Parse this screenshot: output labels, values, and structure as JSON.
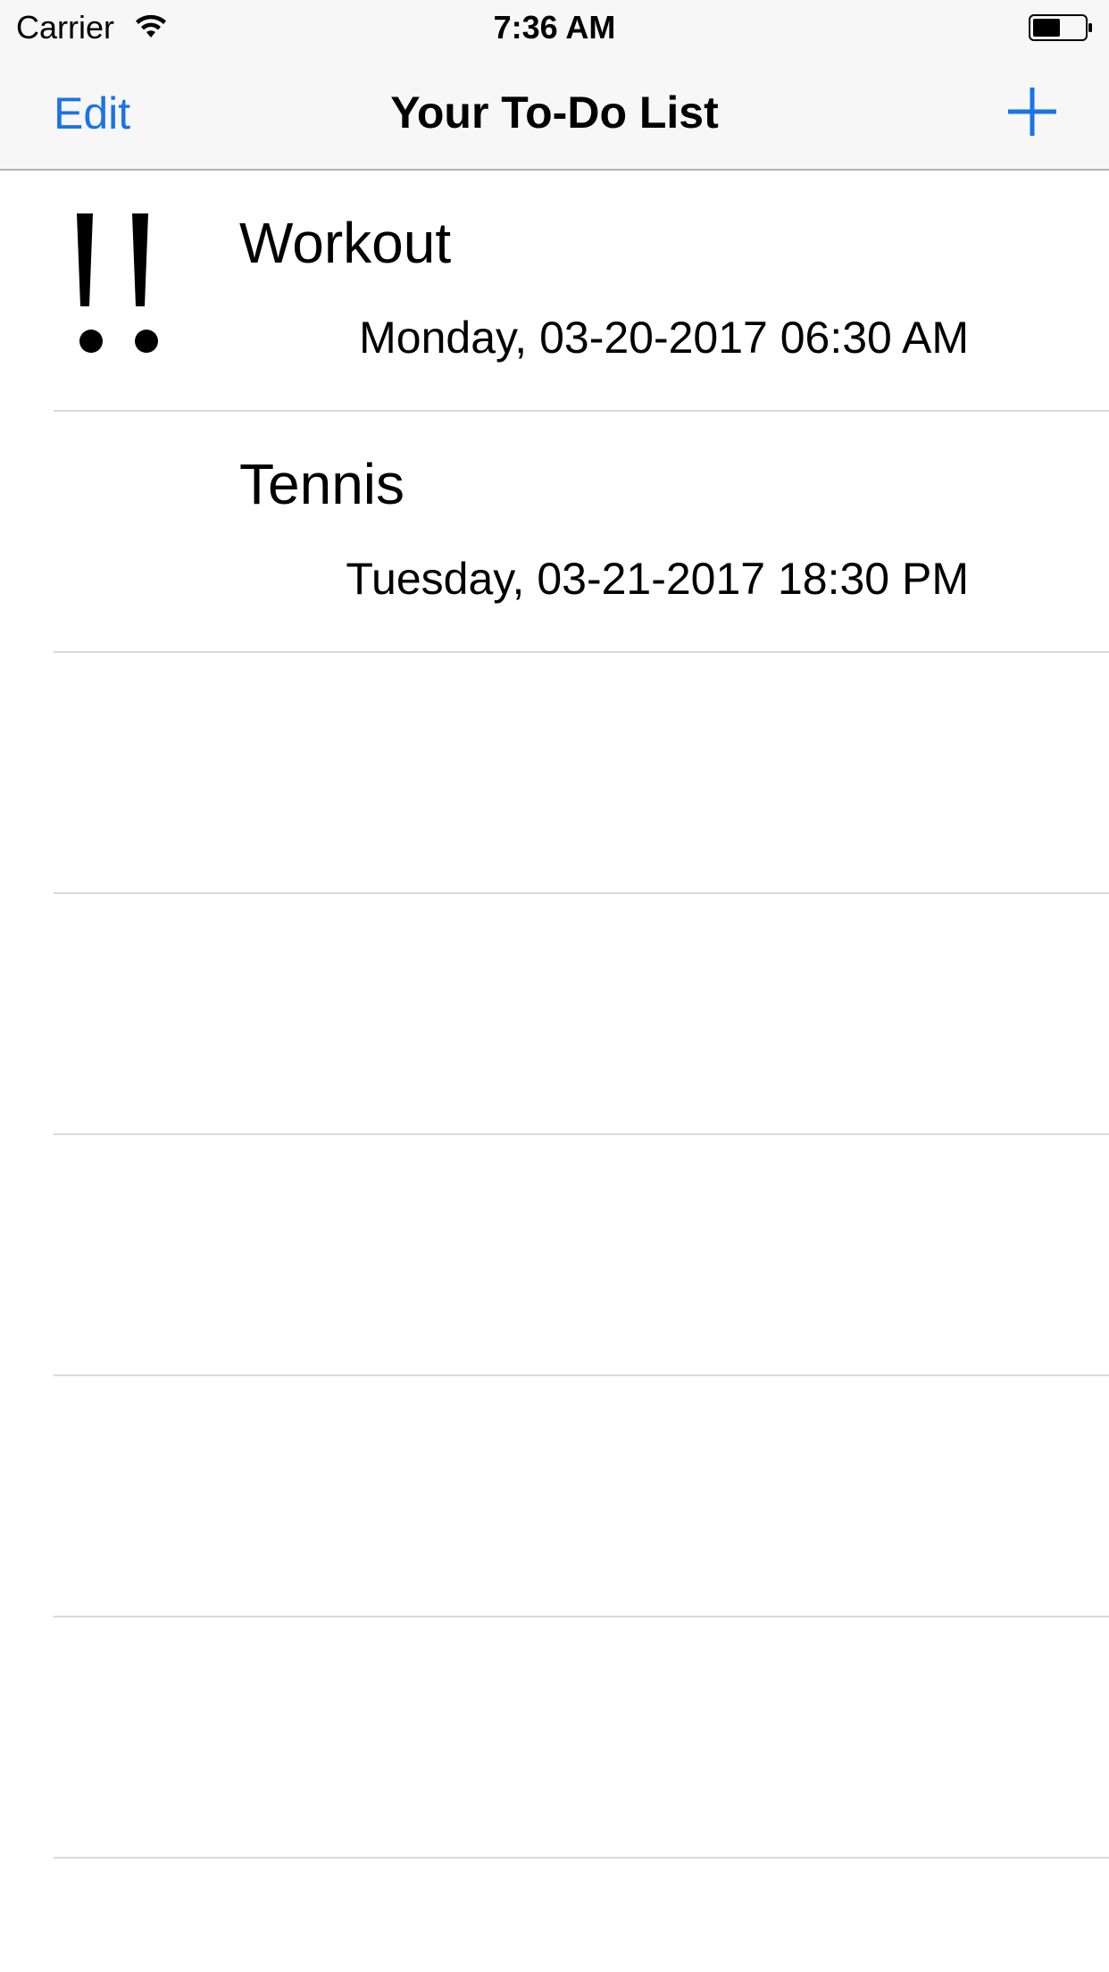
{
  "status_bar": {
    "carrier": "Carrier",
    "time": "7:36 AM",
    "wifi_icon": "wifi-icon",
    "battery_icon": "battery-icon"
  },
  "nav_bar": {
    "edit_label": "Edit",
    "title": "Your To-Do List",
    "add_icon": "plus-icon",
    "accent_color": "#1a73e8"
  },
  "tasks": [
    {
      "title": "Workout",
      "date": "Monday, 03-20-2017 06:30 AM",
      "priority_mark": "!!"
    },
    {
      "title": "Tennis",
      "date": "Tuesday, 03-21-2017 18:30 PM",
      "priority_mark": ""
    }
  ]
}
